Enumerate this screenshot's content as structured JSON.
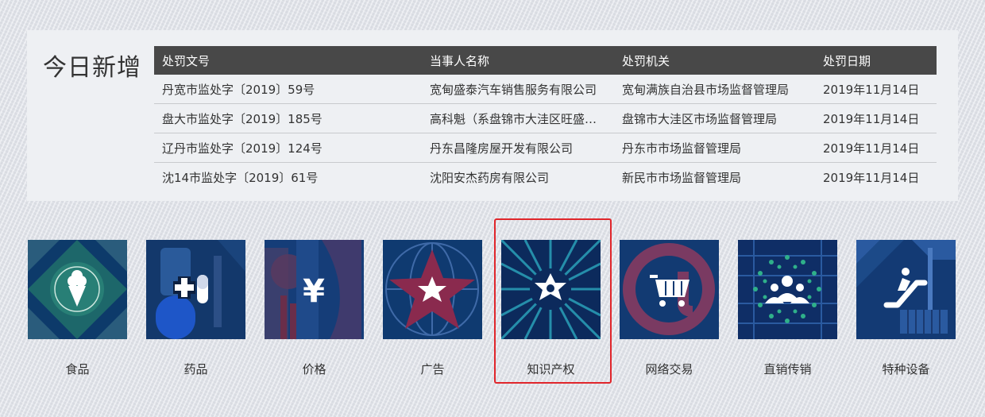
{
  "today": {
    "title": "今日新增",
    "headers": [
      "处罚文号",
      "当事人名称",
      "处罚机关",
      "处罚日期"
    ],
    "rows": [
      [
        "丹宽市监处字〔2019〕59号",
        "宽甸盛泰汽车销售服务有限公司",
        "宽甸满族自治县市场监督管理局",
        "2019年11月14日"
      ],
      [
        "盘大市监处字〔2019〕185号",
        "高科魁（系盘锦市大洼区旺盛…",
        "盘锦市大洼区市场监督管理局",
        "2019年11月14日"
      ],
      [
        "辽丹市监处字〔2019〕124号",
        "丹东昌隆房屋开发有限公司",
        "丹东市市场监督管理局",
        "2019年11月14日"
      ],
      [
        "沈14市监处字〔2019〕61号",
        "沈阳安杰药房有限公司",
        "新民市市场监督管理局",
        "2019年11月14日"
      ]
    ]
  },
  "categories": [
    {
      "label": "食品",
      "icon": "ice-cream-icon"
    },
    {
      "label": "药品",
      "icon": "medicine-icon"
    },
    {
      "label": "价格",
      "icon": "yen-icon"
    },
    {
      "label": "广告",
      "icon": "star-icon"
    },
    {
      "label": "知识产权",
      "icon": "sheriff-badge-icon"
    },
    {
      "label": "网络交易",
      "icon": "shopping-cart-icon"
    },
    {
      "label": "直销传销",
      "icon": "network-people-icon"
    },
    {
      "label": "特种设备",
      "icon": "escalator-icon"
    }
  ],
  "colors": {
    "tile_base": "#0e3a6b",
    "header_bg": "#484848",
    "highlight": "#e0262b"
  }
}
